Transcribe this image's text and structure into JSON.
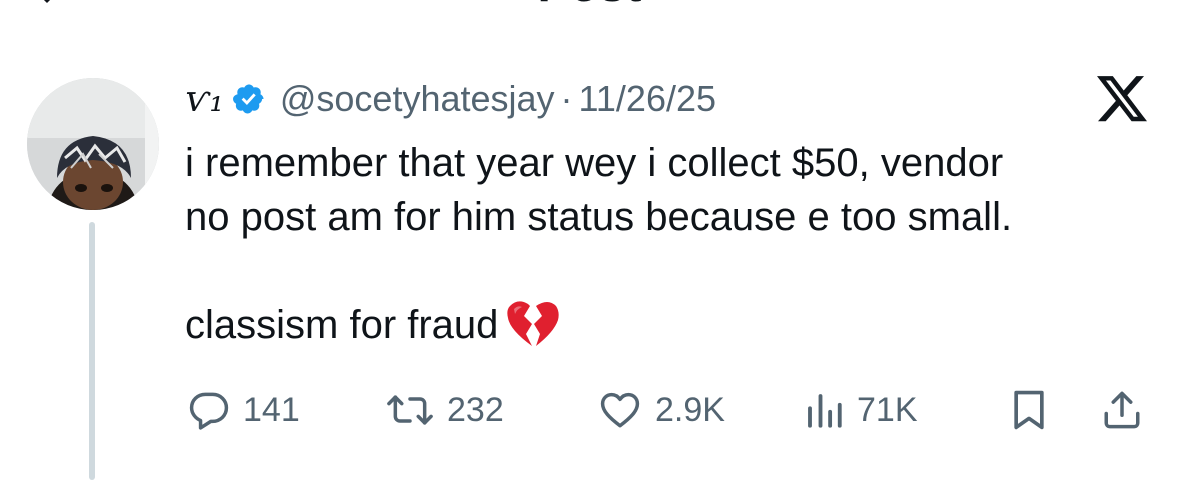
{
  "header": {
    "title": "Post"
  },
  "post": {
    "display_name": "ѵ₁",
    "handle": "@socetyhatesjay",
    "separator": "·",
    "date": "11/26/25",
    "text_lines": [
      "i remember that year wey i collect $50, vendor",
      "no post am for him status because e too small."
    ],
    "text_last_line": "classism for fraud",
    "emoji": "broken-heart"
  },
  "actions": {
    "replies": "141",
    "reposts": "232",
    "likes": "2.9K",
    "views": "71K"
  },
  "icons": {
    "back": "chevron-left-icon",
    "verified": "verified-badge-icon",
    "brand": "x-logo-icon",
    "reply": "reply-icon",
    "repost": "repost-icon",
    "like": "heart-icon",
    "views": "views-icon",
    "bookmark": "bookmark-icon",
    "share": "share-icon"
  },
  "colors": {
    "text": "#0f1419",
    "muted": "#536471",
    "verified": "#1d9bf0",
    "thread_line": "#cfd9de"
  }
}
